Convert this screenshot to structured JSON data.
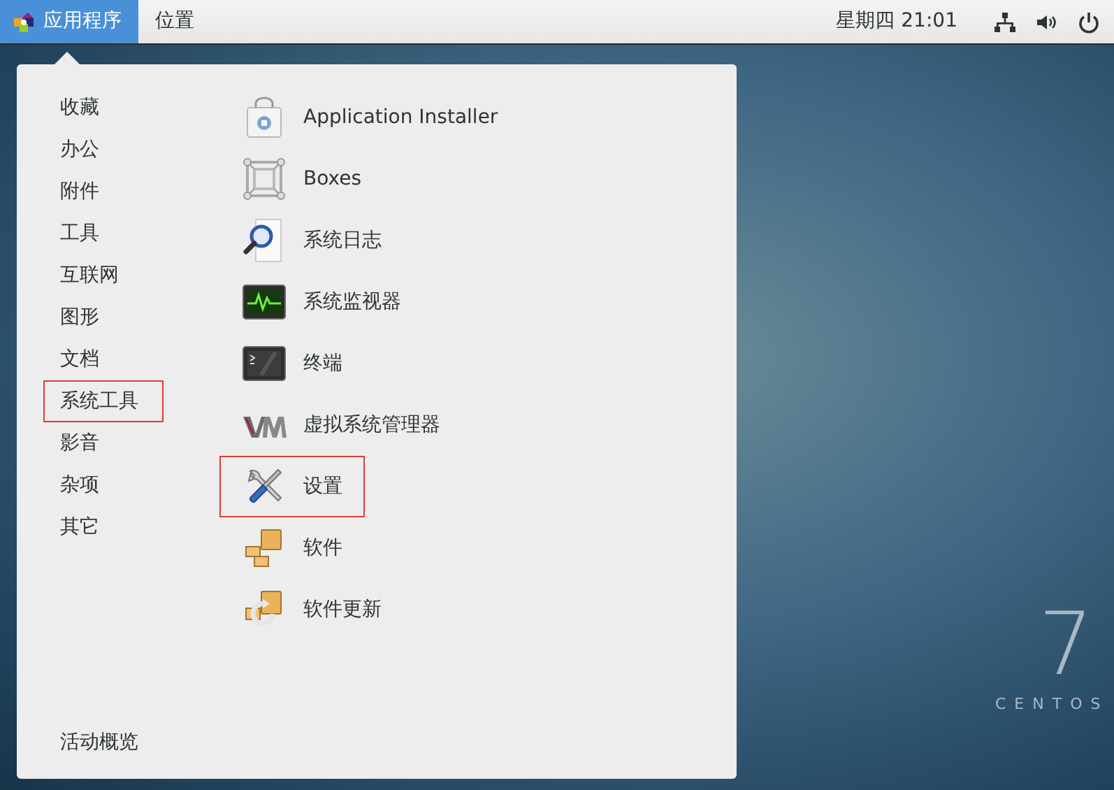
{
  "top_bar": {
    "applications_menu": {
      "label": "应用程序",
      "selected": true
    },
    "places_menu": {
      "label": "位置",
      "selected": false
    },
    "clock": "星期四 21:01"
  },
  "menu": {
    "categories": [
      {
        "label": "收藏",
        "highlighted": false
      },
      {
        "label": "办公",
        "highlighted": false
      },
      {
        "label": "附件",
        "highlighted": false
      },
      {
        "label": "工具",
        "highlighted": false
      },
      {
        "label": "互联网",
        "highlighted": false
      },
      {
        "label": "图形",
        "highlighted": false
      },
      {
        "label": "文档",
        "highlighted": false
      },
      {
        "label": "系统工具",
        "highlighted": true
      },
      {
        "label": "影音",
        "highlighted": false
      },
      {
        "label": "杂项",
        "highlighted": false
      },
      {
        "label": "其它",
        "highlighted": false
      }
    ],
    "apps": [
      {
        "label": "Application Installer",
        "highlighted": false
      },
      {
        "label": "Boxes",
        "highlighted": false
      },
      {
        "label": "系统日志",
        "highlighted": false
      },
      {
        "label": "系统监视器",
        "highlighted": false
      },
      {
        "label": "终端",
        "highlighted": false
      },
      {
        "label": "虚拟系统管理器",
        "highlighted": false
      },
      {
        "label": "设置",
        "highlighted": true
      },
      {
        "label": "软件",
        "highlighted": false
      },
      {
        "label": "软件更新",
        "highlighted": false
      }
    ],
    "activities_overview": "活动概览"
  },
  "desktop": {
    "logo_number": "7",
    "logo_text": "CENTOS"
  }
}
